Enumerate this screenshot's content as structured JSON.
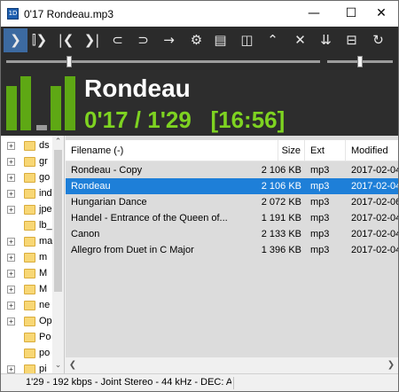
{
  "window": {
    "title": "0'17 Rondeau.mp3",
    "app_icon_text": "1D",
    "minimize": "—",
    "maximize": "☐",
    "close": "✕"
  },
  "toolbar": {
    "buttons": [
      {
        "name": "play-icon",
        "glyph": "❯"
      },
      {
        "name": "play-pause-icon",
        "glyph": "⫿❯"
      },
      {
        "name": "previous-icon",
        "glyph": "|❮"
      },
      {
        "name": "next-icon",
        "glyph": "❯|"
      },
      {
        "name": "open-folder-back-icon",
        "glyph": "⊂"
      },
      {
        "name": "open-folder-forward-icon",
        "glyph": "⊃"
      },
      {
        "name": "jump-icon",
        "glyph": "→"
      },
      {
        "name": "gear-icon",
        "glyph": "⚙"
      },
      {
        "name": "window-layout-icon",
        "glyph": "▤"
      },
      {
        "name": "sidebar-icon",
        "glyph": "◫"
      },
      {
        "name": "collapse-icon",
        "glyph": "⌃"
      },
      {
        "name": "close-icon",
        "glyph": "✕"
      },
      {
        "name": "sort-icon",
        "glyph": "⇊"
      },
      {
        "name": "split-icon",
        "glyph": "⊟"
      },
      {
        "name": "repeat-icon",
        "glyph": "↻"
      }
    ]
  },
  "player": {
    "seek_progress": 0.2,
    "volume_level": 0.5,
    "track_title": "Rondeau",
    "elapsed": "0'17",
    "duration": "1'29",
    "total": "[16:56]",
    "vu_levels": [
      0.78,
      0.95,
      0.1,
      0.78,
      0.95
    ],
    "vu_color": "#5ea814",
    "time_color": "#7ed321"
  },
  "tree": {
    "items": [
      {
        "label": "ds",
        "expandable": true
      },
      {
        "label": "gr",
        "expandable": true
      },
      {
        "label": "go",
        "expandable": true
      },
      {
        "label": "ind",
        "expandable": true
      },
      {
        "label": "jpe",
        "expandable": true
      },
      {
        "label": "lb_",
        "expandable": false
      },
      {
        "label": "ma",
        "expandable": true
      },
      {
        "label": "m",
        "expandable": true
      },
      {
        "label": "M",
        "expandable": true
      },
      {
        "label": "M",
        "expandable": true
      },
      {
        "label": "ne",
        "expandable": true
      },
      {
        "label": "Op",
        "expandable": true
      },
      {
        "label": "Po",
        "expandable": false
      },
      {
        "label": "po",
        "expandable": false
      },
      {
        "label": "pi",
        "expandable": true
      }
    ],
    "scroll_up": "⌃",
    "scroll_down": "⌄"
  },
  "list": {
    "columns": {
      "filename": "Filename (-)",
      "size": "Size",
      "ext": "Ext",
      "modified": "Modified"
    },
    "rows": [
      {
        "filename": "Rondeau - Copy",
        "size": "2 106 KB",
        "ext": "mp3",
        "modified": "2017-02-04",
        "selected": false
      },
      {
        "filename": "Rondeau",
        "size": "2 106 KB",
        "ext": "mp3",
        "modified": "2017-02-04",
        "selected": true
      },
      {
        "filename": "Hungarian Dance",
        "size": "2 072 KB",
        "ext": "mp3",
        "modified": "2017-02-06",
        "selected": false
      },
      {
        "filename": "Handel - Entrance of the Queen of...",
        "size": "1 191 KB",
        "ext": "mp3",
        "modified": "2017-02-04",
        "selected": false
      },
      {
        "filename": "Canon",
        "size": "2 133 KB",
        "ext": "mp3",
        "modified": "2017-02-04",
        "selected": false
      },
      {
        "filename": "Allegro from Duet in C Major",
        "size": "1 396 KB",
        "ext": "mp3",
        "modified": "2017-02-04",
        "selected": false
      }
    ],
    "scroll_left": "❮",
    "scroll_right": "❯",
    "selected_color": "#1e7fd8"
  },
  "status": {
    "text": "1'29 - 192 kbps - Joint Stereo - 44 kHz - DEC: AC"
  }
}
